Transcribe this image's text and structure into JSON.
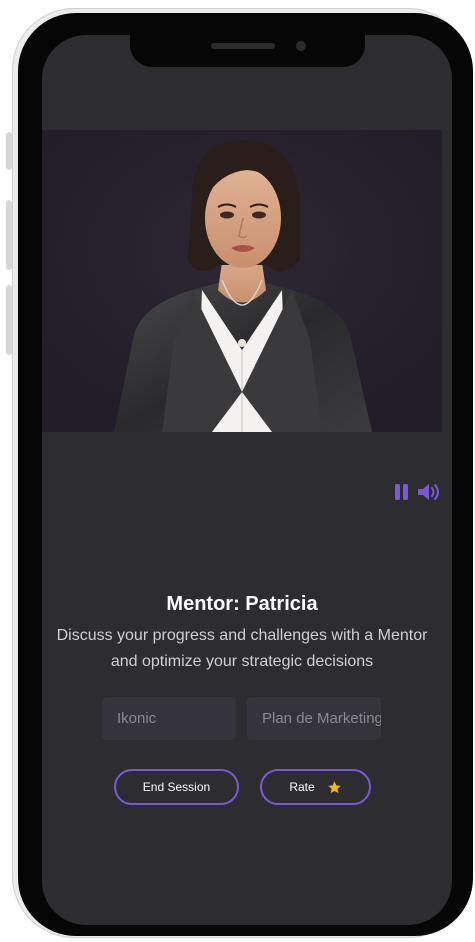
{
  "mentor": {
    "title": "Mentor: Patricia",
    "description": "Discuss your progress and challenges with a Mentor and optimize your strategic decisions"
  },
  "fields": {
    "company_value": "Ikonic",
    "plan_value": "Plan de Marketing"
  },
  "buttons": {
    "end_session_label": "End Session",
    "rate_label": "Rate"
  },
  "icons": {
    "pause": "pause-icon",
    "volume": "volume-icon",
    "star": "star-icon"
  },
  "colors": {
    "accent": "#7d58d6",
    "screen_bg": "#2d2c31",
    "star": "#f5b800"
  }
}
